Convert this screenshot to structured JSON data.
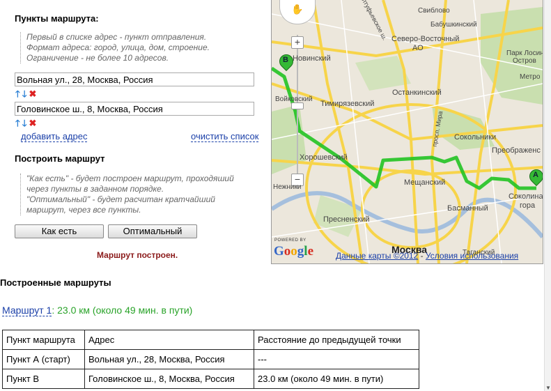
{
  "route_points": {
    "title": "Пункты маршрута:",
    "hints": [
      "Первый в списке адрес - пункт отправления.",
      "Формат адреса: город, улица, дом, строение.",
      "Ограничение - не более 10 адресов."
    ],
    "addresses": [
      "Вольная ул., 28, Москва, Россия",
      "Головинское ш., 8, Москва, Россия"
    ],
    "add_label": "добавить адрес",
    "clear_label": "очистить список"
  },
  "build": {
    "title": "Построить маршрут",
    "hints": [
      "\"Как есть\" - будет построен маршрут, проходяший",
      "через пункты в заданном порядке.",
      "\"Оптимальный\" - будет расчитан кратчайший",
      "маршрут, через все пункты."
    ],
    "as_is_label": "Как есть",
    "optimal_label": "Оптимальный",
    "status": "Маршрут построен."
  },
  "map": {
    "labels": [
      "Бабушкинский",
      "Северо-Восточный",
      "АО",
      "Свиблово",
      "Парк Лосиный",
      "Остров",
      "Метро",
      "Останкинский",
      "Тимирязевский",
      "Сокольники",
      "Преображенс",
      "Хорошевский",
      "Мещанский",
      "Басманный",
      "Соколина",
      "гора",
      "Пресненский",
      "Москва",
      "Таганский",
      "Новинский",
      "Войковский",
      "Нежники",
      "Алтуфьевское ш.",
      "просп. Мира"
    ],
    "copyright": "Данные карты ©2012",
    "terms": "Условия использования",
    "powered_by": "POWERED BY",
    "marker_a": "A",
    "marker_b": "B",
    "zoom_in": "+",
    "zoom_out": "−"
  },
  "results": {
    "title": "Построенные маршруты",
    "route_link": "Маршрут 1",
    "route_summary": ": 23.0 км (около 49 мин. в пути)",
    "headers": [
      "Пункт маршрута",
      "Адрес",
      "Расстояние до предыдущей точки"
    ],
    "rows": [
      [
        "Пункт А (старт)",
        "Вольная ул., 28, Москва, Россия",
        "---"
      ],
      [
        "Пункт B",
        "Головинское ш., 8, Москва, Россия",
        "23.0 км (около 49 мин. в пути)"
      ]
    ]
  },
  "colors": {
    "route": "#22c322",
    "status": "#8b1a1a",
    "summary": "#29a329",
    "link": "#1a3fa8"
  }
}
